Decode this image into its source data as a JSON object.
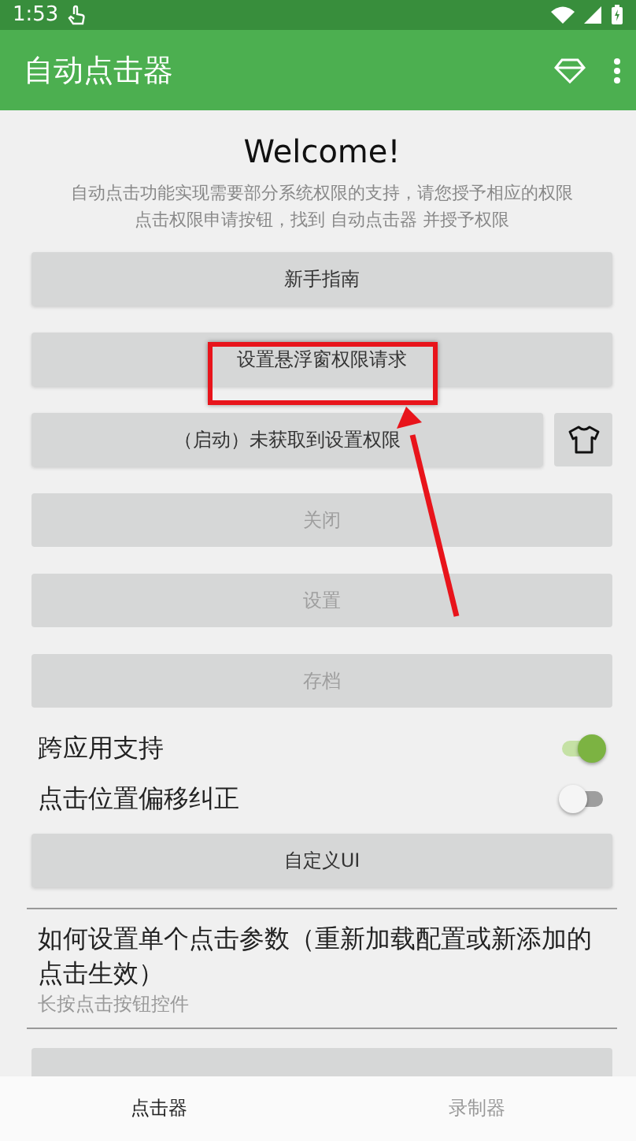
{
  "status_bar": {
    "time": "1:53"
  },
  "app_bar": {
    "title": "自动点击器"
  },
  "welcome": {
    "title": "Welcome!",
    "description_lines": [
      "自动点击功能实现需要部分系统权限的支持，请您授予相应的权限",
      "点击权限申请按钮，找到 自动点击器 并授予权限"
    ]
  },
  "buttons": [
    {
      "label": "新手指南",
      "disabled": false,
      "kind": "plain"
    },
    {
      "label": "设置悬浮窗权限请求",
      "disabled": false,
      "kind": "plain"
    },
    {
      "label": "（启动）未获取到设置权限",
      "disabled": false,
      "kind": "with-shirt"
    },
    {
      "label": "关闭",
      "disabled": true,
      "kind": "plain"
    },
    {
      "label": "设置",
      "disabled": true,
      "kind": "plain"
    },
    {
      "label": "存档",
      "disabled": true,
      "kind": "plain"
    }
  ],
  "toggles": [
    {
      "label": "跨应用支持",
      "on": true
    },
    {
      "label": "点击位置偏移纠正",
      "on": false
    }
  ],
  "custom_ui_button": {
    "label": "自定义UI"
  },
  "help_item": {
    "title": "如何设置单个点击参数（重新加载配置或新添加的点击生效）",
    "subtitle": "长按点击按钮控件"
  },
  "bottom_tabs": [
    {
      "label": "点击器",
      "selected": true
    },
    {
      "label": "录制器",
      "selected": false
    }
  ]
}
